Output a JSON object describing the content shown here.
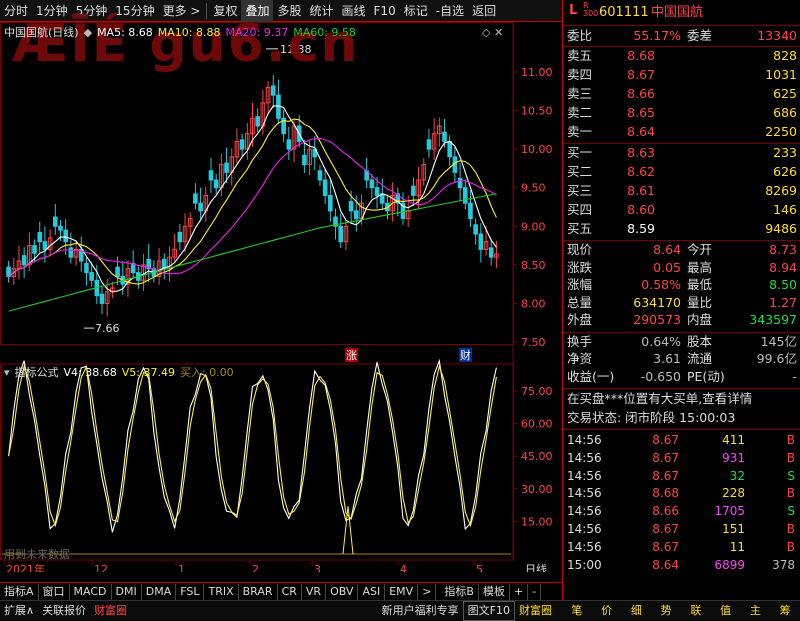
{
  "toolbar": {
    "timeframes": [
      "分时",
      "1分钟",
      "5分钟",
      "15分钟",
      "更多 >"
    ],
    "buttons": [
      "复权",
      "叠加",
      "多股",
      "统计",
      "画线",
      "F10",
      "标记",
      "-自选",
      "返回"
    ],
    "active_button": "叠加"
  },
  "chart_header": {
    "stock": "中国国航(日线)",
    "ma5_label": "MA5: 8.68",
    "ma10_label": "MA10: 8.88",
    "ma20_label": "MA20: 9.37",
    "ma60_label": "MA60: 9.58"
  },
  "watermark": "ÆĪÉ gu6.cn",
  "colors": {
    "up": "#ff4444",
    "down": "#22ccdd",
    "ma5": "#ffffff",
    "ma10": "#ffee33",
    "ma20": "#ee22ee",
    "ma60": "#22cc22",
    "grid": "#7a0000"
  },
  "price_axis": [
    "11.00",
    "10.50",
    "10.00",
    "9.50",
    "9.00",
    "8.50",
    "8.00",
    "7.50"
  ],
  "high_label": "11.38",
  "low_label": "7.66",
  "markers": {
    "zhang": "涨",
    "cai": "财"
  },
  "indicator_header": {
    "name": "指标公式",
    "v4": "V4: 38.68",
    "v5": "V5: 37.49",
    "buy": "买入: 0.00"
  },
  "indicator_axis": [
    "75.00",
    "60.00",
    "45.00",
    "30.00",
    "15.00"
  ],
  "future_note": "用到未来数据",
  "date_axis": {
    "labels": [
      "2021年",
      "12",
      "1",
      "2",
      "3",
      "4",
      "5"
    ],
    "period": "日线"
  },
  "indicator_tabs": [
    "指标A",
    "窗口",
    "MACD",
    "DMI",
    "DMA",
    "FSL",
    "TRIX",
    "BRAR",
    "CR",
    "VR",
    "OBV",
    "ASI",
    "EMV",
    ">",
    "指标B",
    "模板",
    "+",
    "-"
  ],
  "status_bar": {
    "items": [
      "扩展∧",
      "关联报价",
      "财富圈",
      "新用户福利专享",
      "图文F10",
      "财富圈"
    ],
    "right_tabs": [
      "笔",
      "价",
      "细",
      "势",
      "联",
      "值",
      "主",
      "筹"
    ]
  },
  "quote": {
    "tag": "L",
    "tag2": "R\n300",
    "code": "601111",
    "name": "中国国航",
    "weibi_label": "委比",
    "weibi": "55.17%",
    "weicha_label": "委差",
    "weicha": "13340",
    "asks": [
      {
        "label": "卖五",
        "price": "8.68",
        "vol": "828"
      },
      {
        "label": "卖四",
        "price": "8.67",
        "vol": "1031"
      },
      {
        "label": "卖三",
        "price": "8.66",
        "vol": "625"
      },
      {
        "label": "卖二",
        "price": "8.65",
        "vol": "686"
      },
      {
        "label": "卖一",
        "price": "8.64",
        "vol": "2250"
      }
    ],
    "bids": [
      {
        "label": "买一",
        "price": "8.63",
        "vol": "233"
      },
      {
        "label": "买二",
        "price": "8.62",
        "vol": "626"
      },
      {
        "label": "买三",
        "price": "8.61",
        "vol": "8269"
      },
      {
        "label": "买四",
        "price": "8.60",
        "vol": "146"
      },
      {
        "label": "买五",
        "price": "8.59",
        "vol": "9486"
      }
    ],
    "stats": [
      {
        "l1": "现价",
        "v1": "8.64",
        "l2": "今开",
        "v2": "8.73"
      },
      {
        "l1": "涨跌",
        "v1": "0.05",
        "l2": "最高",
        "v2": "8.94"
      },
      {
        "l1": "涨幅",
        "v1": "0.58%",
        "l2": "最低",
        "v2": "8.50"
      },
      {
        "l1": "总量",
        "v1": "634170",
        "l2": "量比",
        "v2": "1.27"
      },
      {
        "l1": "外盘",
        "v1": "290573",
        "l2": "内盘",
        "v2": "343597"
      }
    ],
    "stats2": [
      {
        "l1": "换手",
        "v1": "0.64%",
        "l2": "股本",
        "v2": "145亿"
      },
      {
        "l1": "净资",
        "v1": "3.61",
        "l2": "流通",
        "v2": "99.6亿"
      },
      {
        "l1": "收益(一)",
        "v1": "-0.650",
        "l2": "PE(动)",
        "v2": "-"
      }
    ],
    "notice": "在买盘***位置有大买单,查看详情",
    "trade_state": "交易状态: 闭市阶段  15:00:03",
    "ticks": [
      {
        "t": "14:56",
        "p": "8.67",
        "v": "411",
        "s": "B"
      },
      {
        "t": "14:56",
        "p": "8.67",
        "v": "931",
        "s": "B"
      },
      {
        "t": "14:56",
        "p": "8.67",
        "v": "32",
        "s": "S"
      },
      {
        "t": "14:56",
        "p": "8.68",
        "v": "228",
        "s": "B"
      },
      {
        "t": "14:56",
        "p": "8.66",
        "v": "1705",
        "s": "S"
      },
      {
        "t": "14:56",
        "p": "8.67",
        "v": "151",
        "s": "B"
      },
      {
        "t": "14:56",
        "p": "8.67",
        "v": "11",
        "s": "B"
      },
      {
        "t": "15:00",
        "p": "8.64",
        "v": "6899",
        "s": "378"
      }
    ]
  }
}
